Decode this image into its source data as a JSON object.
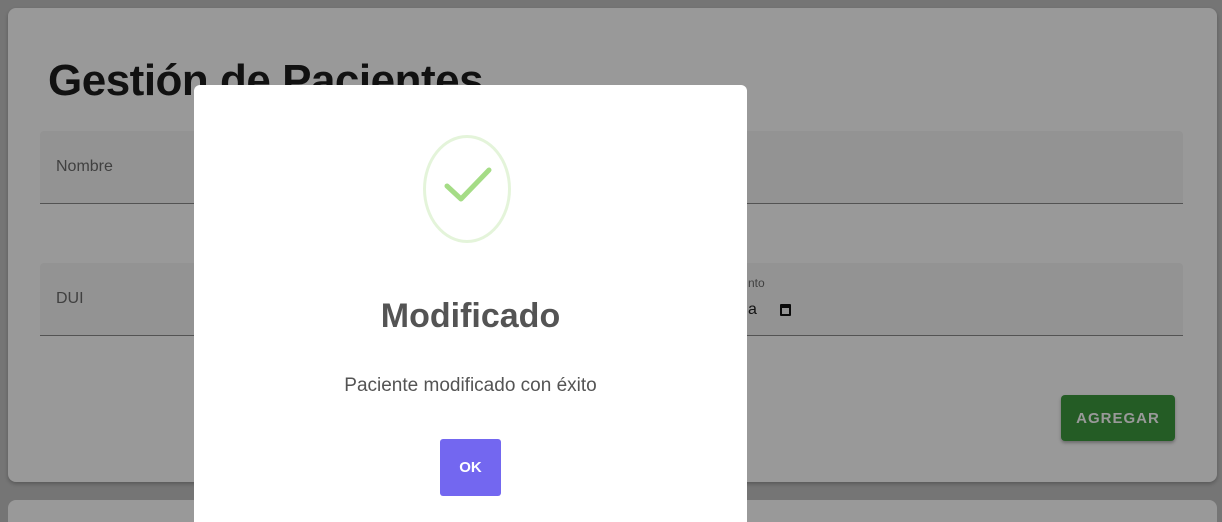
{
  "page": {
    "title": "Gestión de Pacientes"
  },
  "form": {
    "nombre_label": "Nombre",
    "dui_label": "DUI",
    "fecha_label_fragment": "nto",
    "fecha_value_fragment": "a",
    "agregar_label": "AGREGAR"
  },
  "modal": {
    "title": "Modificado",
    "message": "Paciente modificado con éxito",
    "ok_label": "OK",
    "icon": "success-check-icon"
  },
  "colors": {
    "agregar_button": "#3c9a3f",
    "ok_button": "#7367f0",
    "success_check": "#a5dc86"
  }
}
